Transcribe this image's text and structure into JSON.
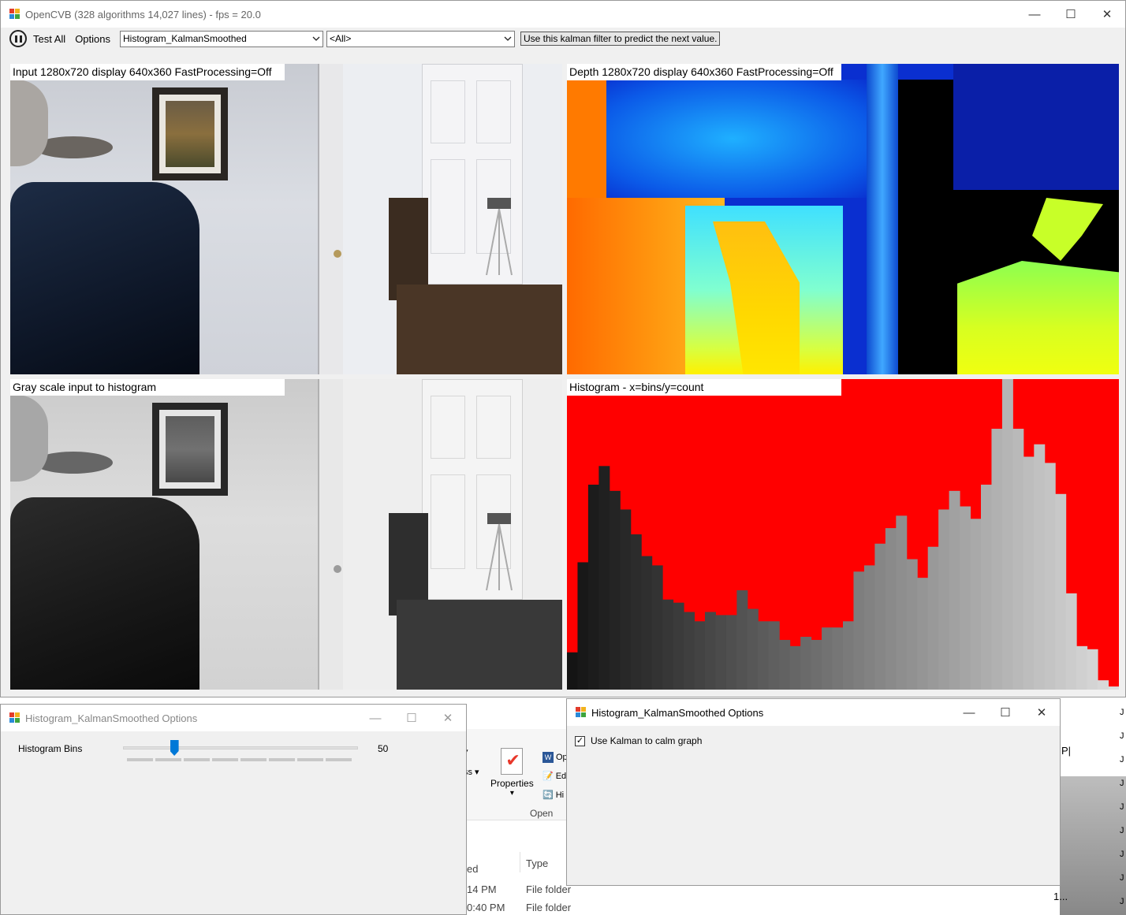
{
  "main_window": {
    "title": "OpenCVB (328 algorithms 14,027 lines) - fps = 20.0",
    "minimize": "—",
    "maximize": "☐",
    "close": "✕"
  },
  "toolbar": {
    "test_all": "Test All",
    "options": "Options",
    "algorithm_select": "Histogram_KalmanSmoothed",
    "group_select": "<All>",
    "description": "Use this kalman filter to predict the next value."
  },
  "panels": {
    "input_label": "Input 1280x720 display 640x360 FastProcessing=Off",
    "depth_label": "Depth 1280x720 display 640x360 FastProcessing=Off",
    "gray_label": "Gray scale input to histogram",
    "hist_label": "Histogram - x=bins/y=count"
  },
  "histogram_data": {
    "background_color": "#ff0000",
    "bins": [
      12,
      41,
      66,
      72,
      64,
      58,
      50,
      43,
      40,
      29,
      28,
      25,
      22,
      25,
      24,
      24,
      32,
      26,
      22,
      22,
      16,
      14,
      17,
      16,
      20,
      20,
      22,
      38,
      40,
      47,
      52,
      56,
      42,
      36,
      46,
      58,
      64,
      59,
      55,
      66,
      84,
      100,
      84,
      75,
      79,
      73,
      63,
      31,
      14,
      13,
      3,
      1
    ]
  },
  "options1": {
    "title": "Histogram_KalmanSmoothed Options",
    "slider_label": "Histogram Bins",
    "slider_value": "50",
    "slider_fraction": 0.2
  },
  "options2": {
    "title": "Histogram_KalmanSmoothed Options",
    "checkbox_label": "Use Kalman to calm graph",
    "checkbox_checked": true
  },
  "explorer": {
    "properties_label": "Properties",
    "open_group": "Open",
    "ribbon_items": [
      "Op",
      "Ed",
      "Hi"
    ],
    "ribbon_fragment": "ss ▾",
    "col_modified": "ed",
    "col_type": "Type",
    "rows": [
      {
        "time": "14 PM",
        "type": "File folder"
      },
      {
        "time": "0:40 PM",
        "type": "File folder"
      }
    ],
    "right_strip": [
      "J",
      "J",
      "J",
      "J",
      "J",
      "J",
      "J",
      "J",
      "J",
      "J"
    ],
    "right_marks": [
      "P|",
      "1..."
    ]
  }
}
